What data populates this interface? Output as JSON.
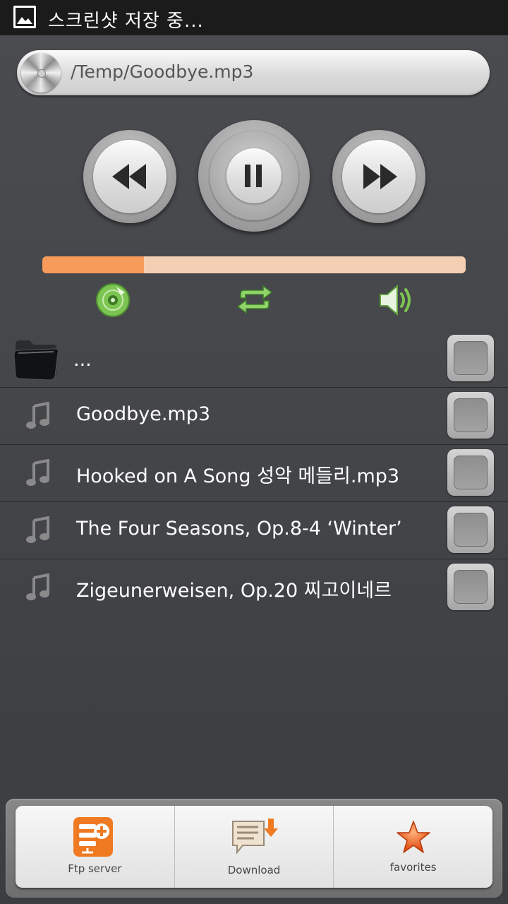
{
  "status_bar": {
    "text": "스크린샷 저장 중..."
  },
  "player": {
    "current_path": "/Temp/Goodbye.mp3",
    "progress": 0.24
  },
  "list": {
    "parent_label": "...",
    "items": [
      {
        "label": "Goodbye.mp3"
      },
      {
        "label": "Hooked on A Song 성악 메들리.mp3"
      },
      {
        "label": "The Four Seasons, Op.8-4 ‘Winter’"
      },
      {
        "label": "Zigeunerweisen, Op.20 찌고이네르"
      }
    ]
  },
  "bottom_bar": {
    "ftp_label": "Ftp server",
    "download_label": "Download",
    "favorites_label": "favorites"
  },
  "colors": {
    "progress_fill": "#f79b5b",
    "progress_track": "#f4cfb4",
    "accent_green": "#6cb64a",
    "ftp_orange": "#f07a22"
  }
}
